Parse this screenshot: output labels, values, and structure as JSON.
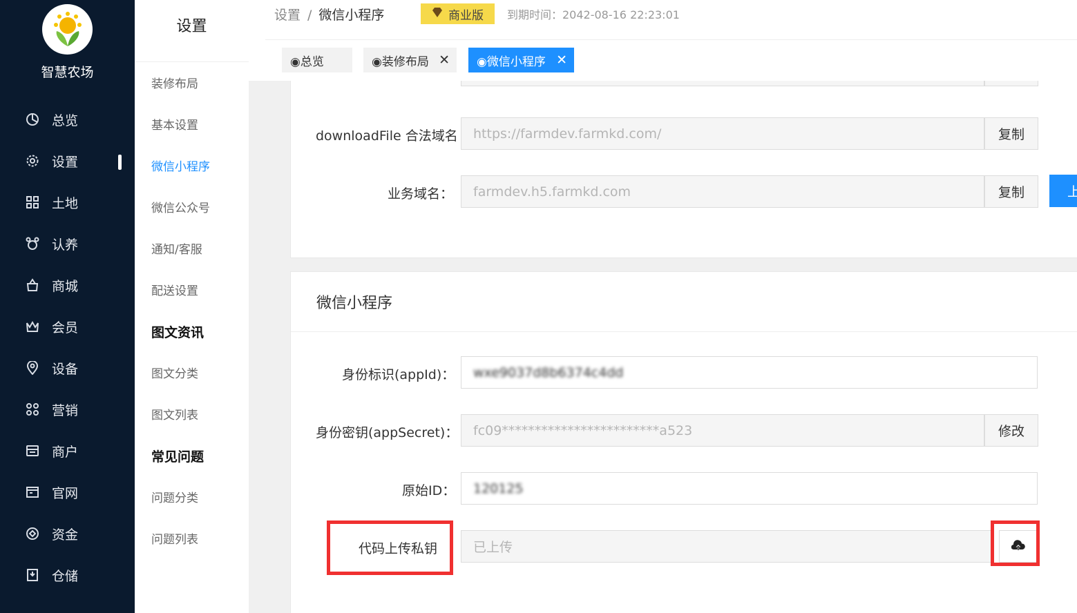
{
  "sidebar": {
    "brand": "智慧农场",
    "items": [
      {
        "label": "总览",
        "icon": "dashboard-icon"
      },
      {
        "label": "设置",
        "icon": "gear-icon"
      },
      {
        "label": "土地",
        "icon": "grid-icon"
      },
      {
        "label": "认养",
        "icon": "adopt-icon"
      },
      {
        "label": "商城",
        "icon": "shop-icon"
      },
      {
        "label": "会员",
        "icon": "crown-icon"
      },
      {
        "label": "设备",
        "icon": "location-pin-icon"
      },
      {
        "label": "营销",
        "icon": "marketing-icon"
      },
      {
        "label": "商户",
        "icon": "store-icon"
      },
      {
        "label": "官网",
        "icon": "website-icon"
      },
      {
        "label": "资金",
        "icon": "fund-icon"
      },
      {
        "label": "仓储",
        "icon": "warehouse-icon"
      }
    ],
    "active_item": "设置"
  },
  "subnav": {
    "title": "设置",
    "items": [
      {
        "label": "装修布局"
      },
      {
        "label": "基本设置"
      },
      {
        "label": "微信小程序"
      },
      {
        "label": "微信公众号"
      },
      {
        "label": "通知/客服"
      },
      {
        "label": "配送设置"
      }
    ],
    "active_item": "微信小程序",
    "section_news": "图文资讯",
    "news_items": [
      {
        "label": "图文分类"
      },
      {
        "label": "图文列表"
      }
    ],
    "section_faq": "常见问题",
    "faq_items": [
      {
        "label": "问题分类"
      },
      {
        "label": "问题列表"
      }
    ]
  },
  "header": {
    "breadcrumb_root": "设置",
    "breadcrumb_sep": "/",
    "breadcrumb_current": "微信小程序",
    "edition_badge": "商业版",
    "expire_text": "到期时间：2042-08-16 22:23:01"
  },
  "tabs": [
    {
      "label": "◉总览",
      "closable": false
    },
    {
      "label": "◉装修布局",
      "closable": true
    },
    {
      "label": "◉微信小程序",
      "closable": true
    }
  ],
  "tab_close_glyph": "✕",
  "domains_card": {
    "download_label": "downloadFile 合法域名",
    "download_value": "https://farmdev.farmkd.com/",
    "business_label": "业务域名：",
    "business_value": "farmdev.h5.farmkd.com",
    "copy_label": "复制",
    "upload_btn_label": "上"
  },
  "miniprogram_card": {
    "title": "微信小程序",
    "appid_label": "身份标识(appId)：",
    "appid_value": "wxe9037d8b6374c4dd",
    "secret_label": "身份密钥(appSecret)：",
    "secret_value": "fc09************************a523",
    "secret_button": "修改",
    "origin_label": "原始ID：",
    "origin_value": "120125",
    "key_label": "代码上传私钥",
    "key_value": "已上传",
    "upload_icon": "cloud-upload-icon"
  },
  "colors": {
    "sidebar_bg": "#0a1a2e",
    "accent": "#1e90ff",
    "badge": "#f6d94a",
    "highlight": "#f03030"
  }
}
